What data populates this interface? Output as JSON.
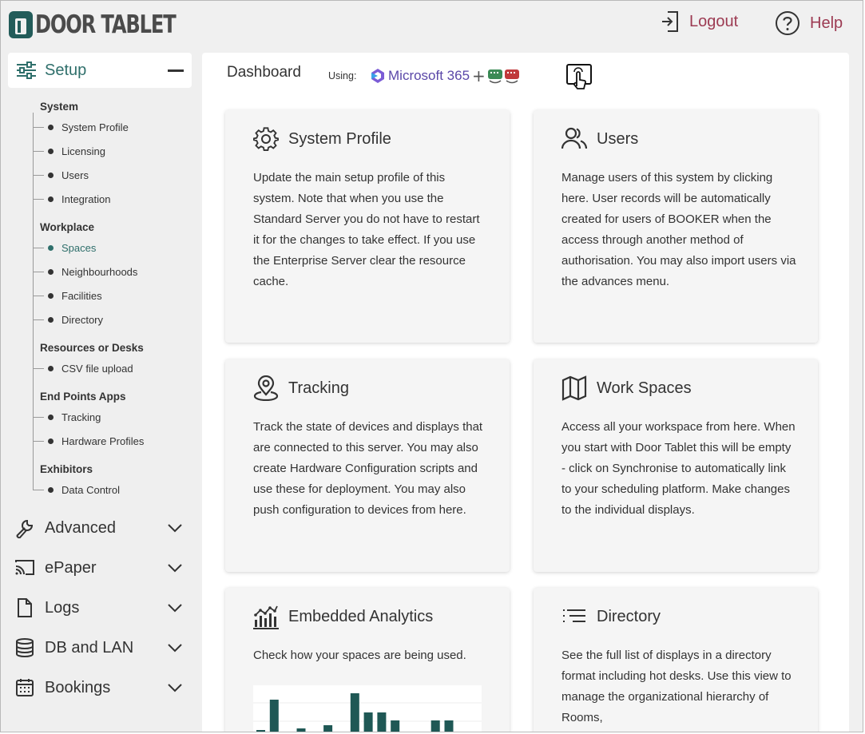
{
  "header": {
    "logo_text": "DOOR TABLET",
    "logout_label": "Logout",
    "help_label": "Help"
  },
  "sidebar": {
    "setup_label": "Setup",
    "groups": [
      {
        "title": "System",
        "items": [
          "System Profile",
          "Licensing",
          "Users",
          "Integration"
        ]
      },
      {
        "title": "Workplace",
        "items": [
          "Spaces",
          "Neighbourhoods",
          "Facilities",
          "Directory"
        ]
      },
      {
        "title": "Resources or Desks",
        "items": [
          "CSV file upload"
        ]
      },
      {
        "title": "End Points Apps",
        "items": [
          "Tracking",
          "Hardware Profiles"
        ]
      },
      {
        "title": "Exhibitors",
        "items": [
          "Data Control"
        ]
      }
    ],
    "active_item": "Spaces",
    "sections": [
      "Advanced",
      "ePaper",
      "Logs",
      "DB and LAN",
      "Bookings"
    ]
  },
  "main": {
    "breadcrumb": "Dashboard",
    "using_label": "Using:",
    "integration_name": "Microsoft 365",
    "integration_plus": "+",
    "cards": [
      {
        "title": "System Profile",
        "icon": "gear-icon",
        "desc": "Update the main setup profile of this system. Note that when you use the Standard Server you do not have to restart it for the changes to take effect. If you use the Enterprise Server clear the resource cache."
      },
      {
        "title": "Users",
        "icon": "users-icon",
        "desc": "Manage users of this system by clicking here. User records will be automatically created for users of BOOKER when the access through another method of authorisation. You may also import users via the advances menu."
      },
      {
        "title": "Tracking",
        "icon": "location-pin-icon",
        "desc": "Track the state of devices and displays that are connected to this server. You may also create Hardware Configuration scripts and use these for deployment. You may also push configuration to devices from here."
      },
      {
        "title": "Work Spaces",
        "icon": "map-icon",
        "desc": "Access all your workspace from here. When you start with Door Tablet this will be empty - click on Synchronise to automatically link to your scheduling platform. Make changes to the individual displays."
      },
      {
        "title": "Embedded Analytics",
        "icon": "analytics-icon",
        "desc": "Check how your spaces are being used."
      },
      {
        "title": "Directory",
        "icon": "list-icon",
        "desc": "See the full list of displays in a directory format including hot desks. Use this view to manage the organizational hierarchy of Rooms,"
      }
    ],
    "mini_chart": {
      "values": [
        4,
        42,
        0,
        6,
        0,
        10,
        0,
        50,
        26,
        26,
        16,
        0,
        0,
        16,
        16
      ]
    }
  },
  "colors": {
    "accent": "#2f6f6b",
    "link": "#9c3a52",
    "bar": "#1f5855"
  }
}
